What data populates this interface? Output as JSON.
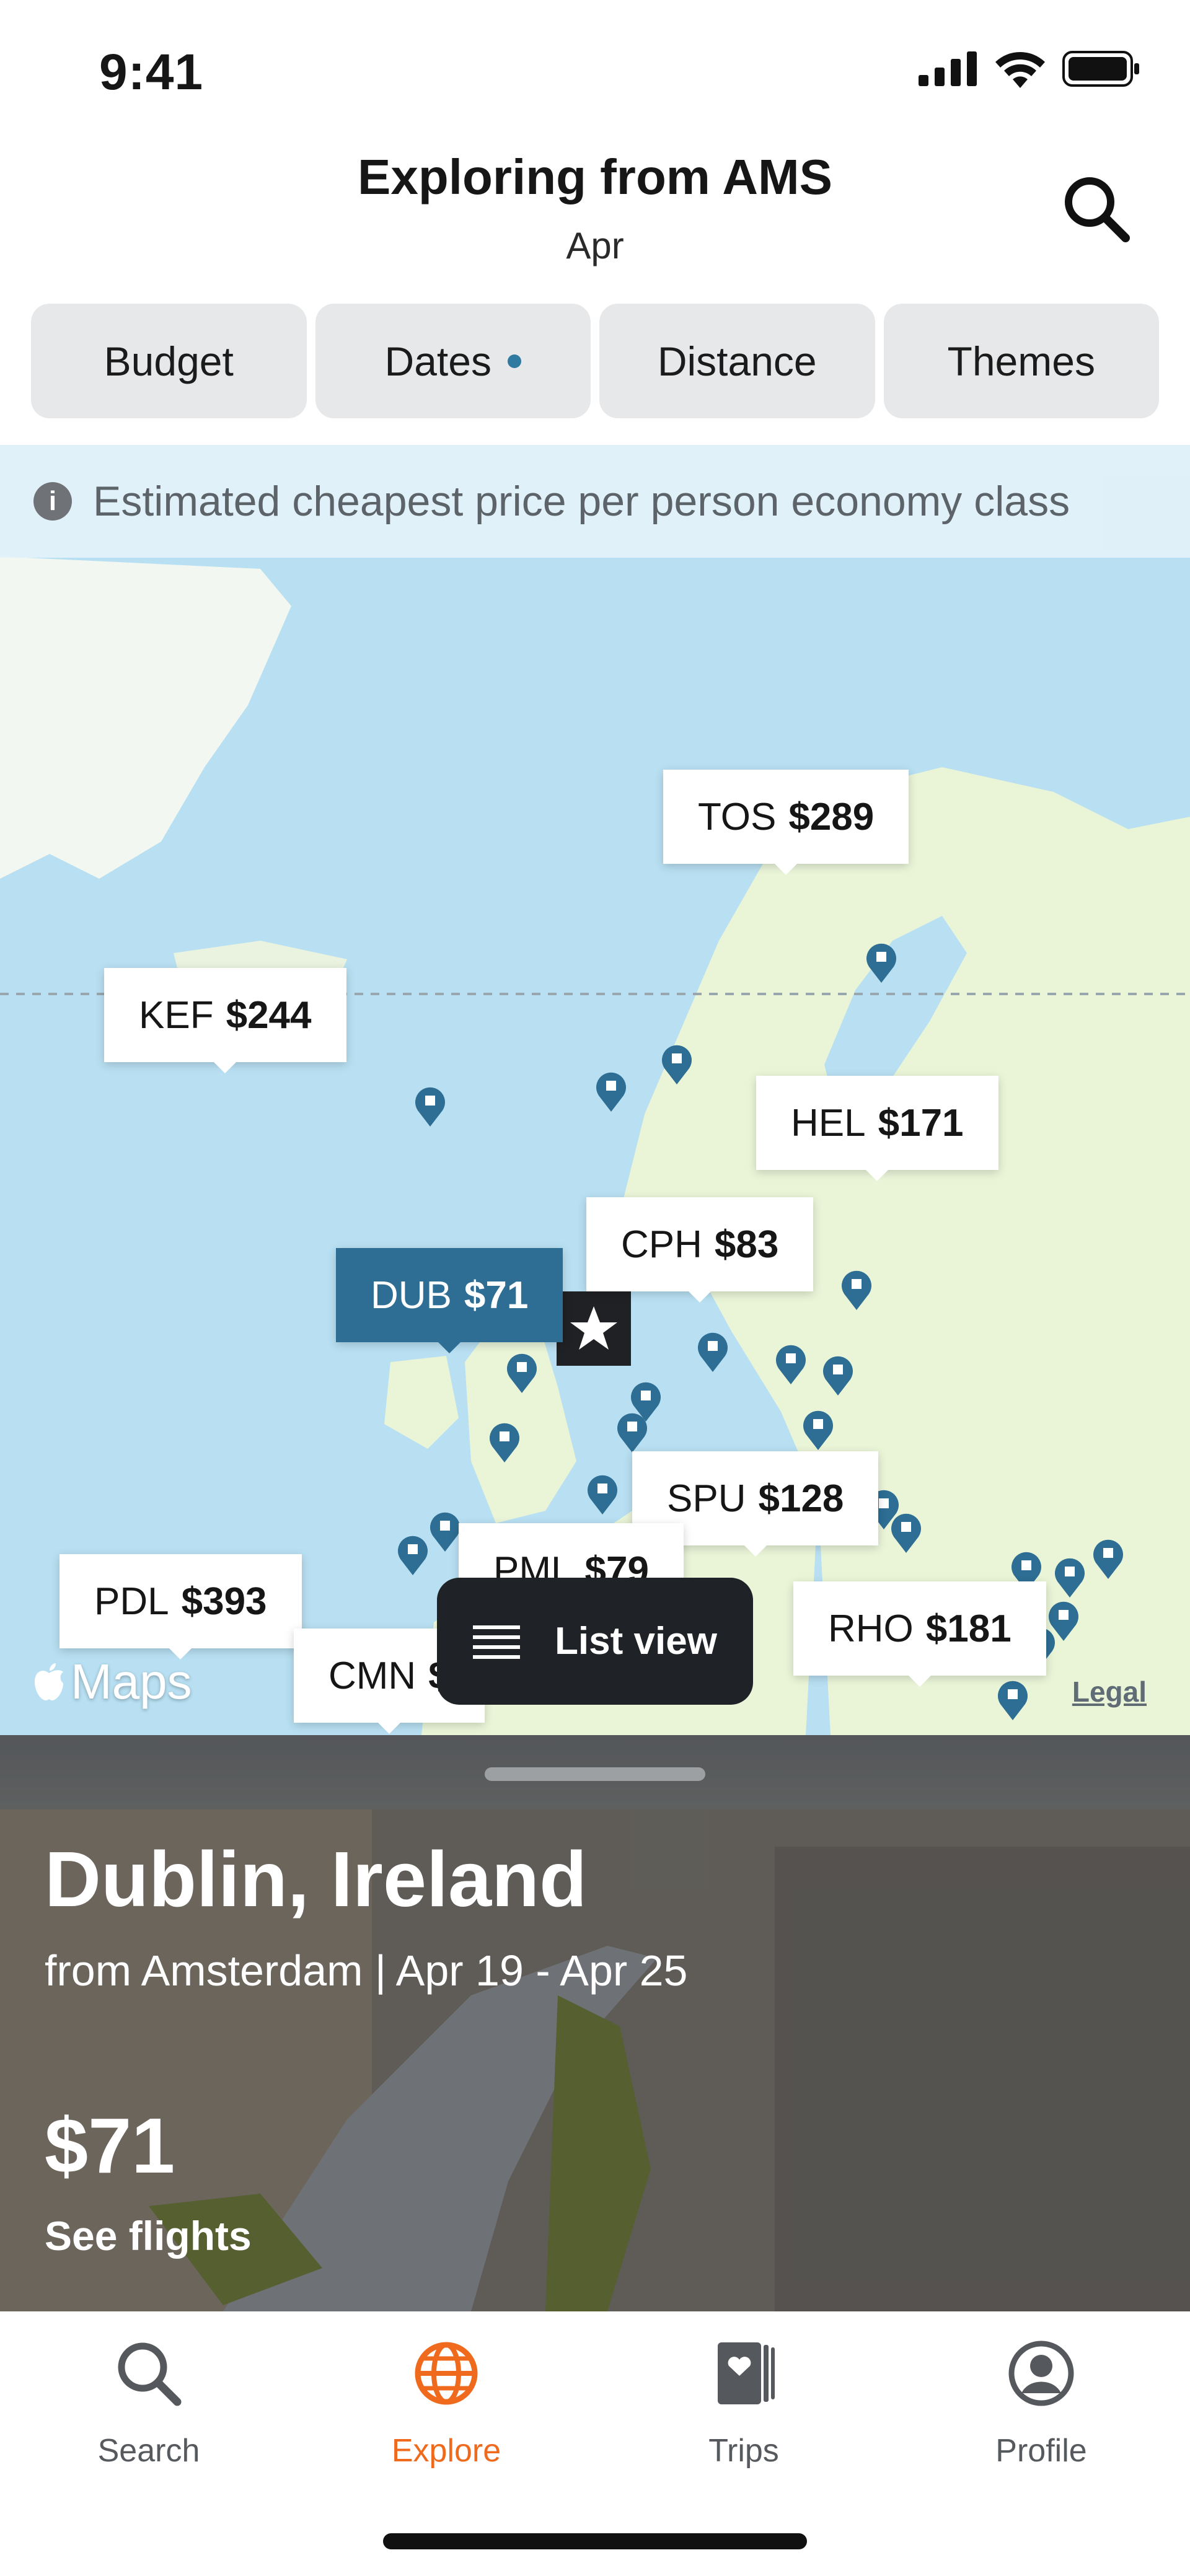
{
  "status_bar": {
    "time": "9:41"
  },
  "header": {
    "title": "Exploring from AMS",
    "subtitle": "Apr"
  },
  "filters": [
    {
      "label": "Budget",
      "active": false
    },
    {
      "label": "Dates",
      "active": true
    },
    {
      "label": "Distance",
      "active": false
    },
    {
      "label": "Themes",
      "active": false
    }
  ],
  "map": {
    "info": "Estimated cheapest price per person economy class",
    "pins": [
      {
        "code": "TOS",
        "price": "$289"
      },
      {
        "code": "KEF",
        "price": "$244"
      },
      {
        "code": "HEL",
        "price": "$171"
      },
      {
        "code": "CPH",
        "price": "$83"
      },
      {
        "code": "DUB",
        "price": "$71",
        "selected": true
      },
      {
        "code": "SPU",
        "price": "$128"
      },
      {
        "code": "PML",
        "price": "$79"
      },
      {
        "code": "PDL",
        "price": "$393"
      },
      {
        "code": "RHO",
        "price": "$181"
      },
      {
        "code": "CMN",
        "price": "$"
      }
    ],
    "list_view_label": "List view",
    "attribution": "Maps",
    "legal": "Legal",
    "colors": {
      "selected_pin": "#2e6e94",
      "marker": "#2e6e94",
      "water": "#bfe4f4",
      "land": "#eaf5d8"
    }
  },
  "destination": {
    "title": "Dublin, Ireland",
    "subtitle": "from Amsterdam | Apr 19 - Apr 25",
    "price": "$71",
    "cta": "See flights"
  },
  "tabs": [
    {
      "label": "Search",
      "icon": "search-icon",
      "active": false
    },
    {
      "label": "Explore",
      "icon": "globe-icon",
      "active": true
    },
    {
      "label": "Trips",
      "icon": "trips-icon",
      "active": false
    },
    {
      "label": "Profile",
      "icon": "profile-icon",
      "active": false
    }
  ],
  "accent_color": "#ef6a1d"
}
